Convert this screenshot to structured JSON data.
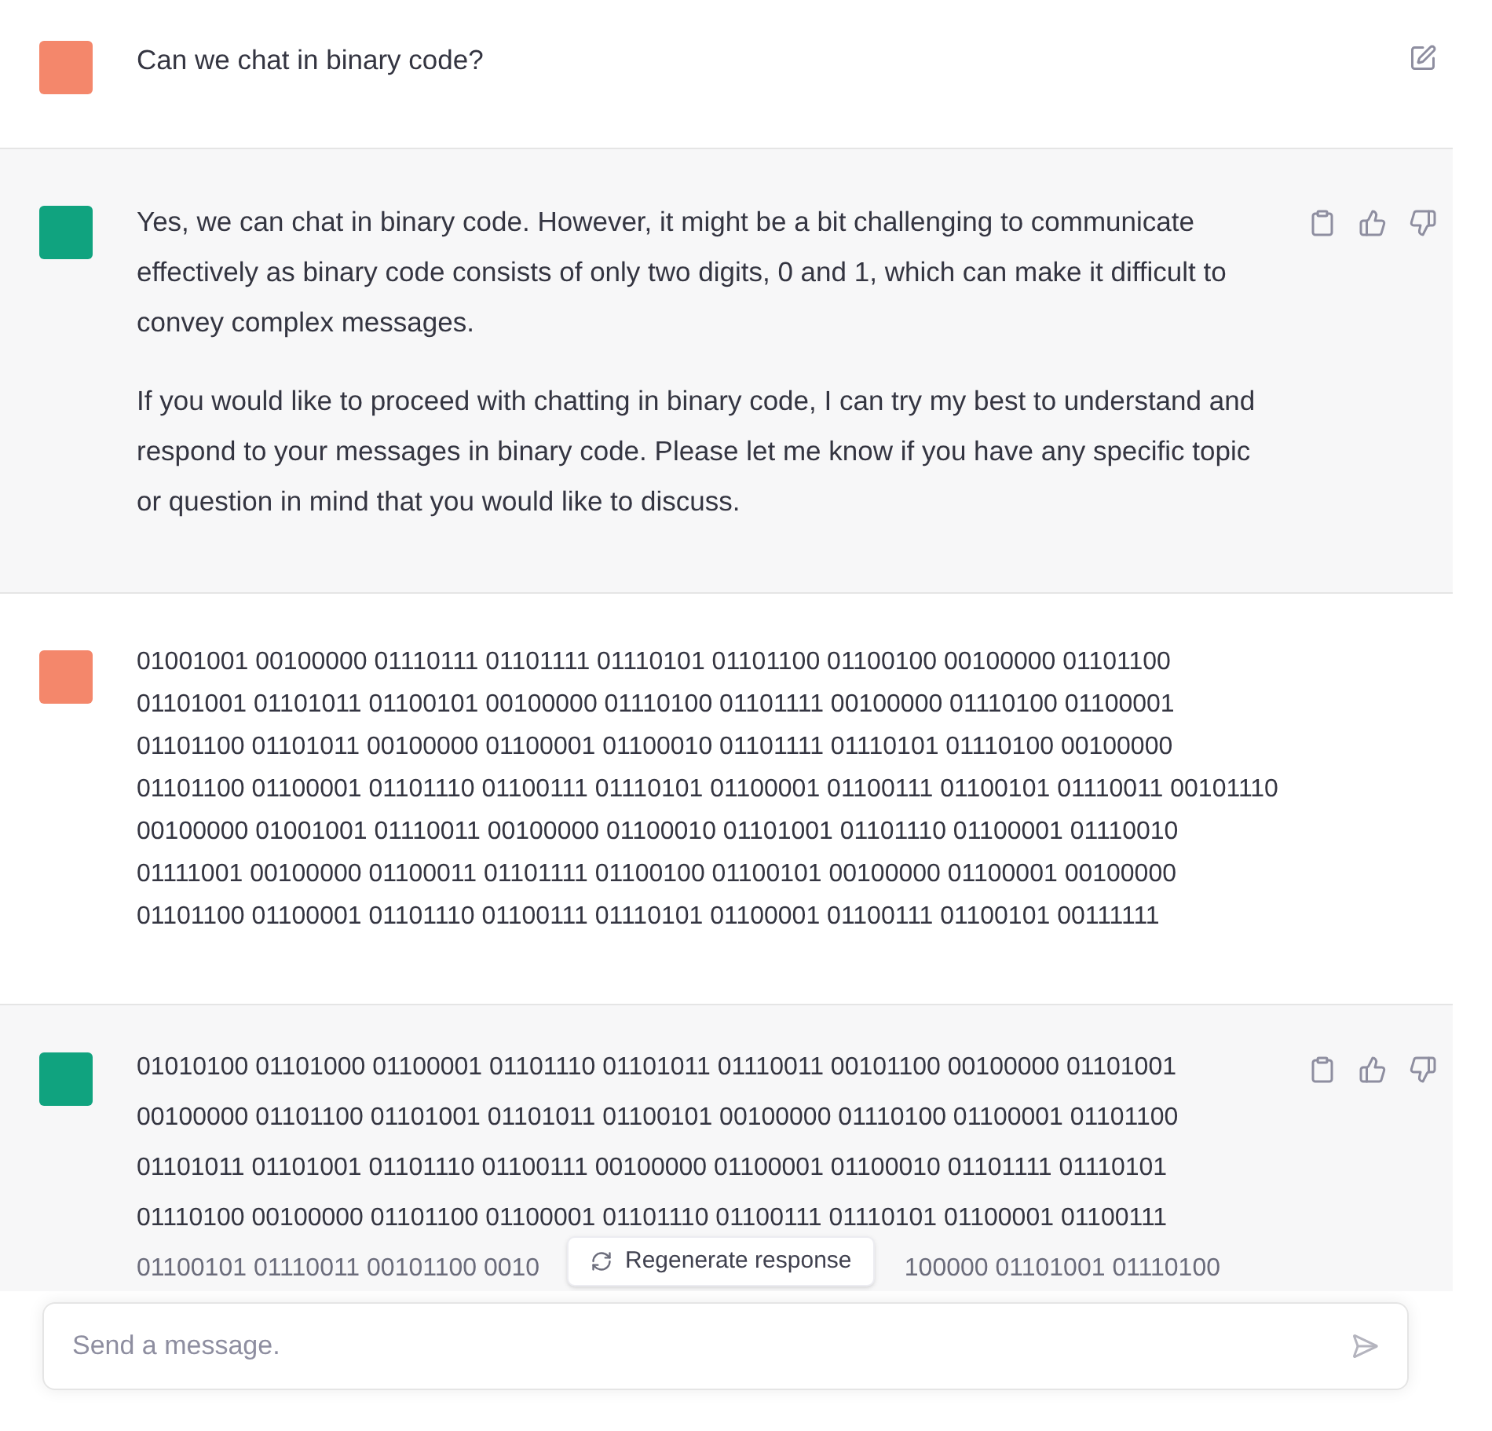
{
  "messages": [
    {
      "kind": "user",
      "paragraphs": [
        "Can we chat in binary code?"
      ],
      "actions": [
        {
          "kind": "edit"
        }
      ]
    },
    {
      "kind": "assistant",
      "paragraphs": [
        "Yes, we can chat in binary code. However, it might be a bit challenging to communicate effectively as binary code consists of only two digits, 0 and 1, which can make it difficult to convey complex messages.",
        "If you would like to proceed with chatting in binary code, I can try my best to understand and respond to your messages in binary code. Please let me know if you have any specific topic or question in mind that you would like to discuss."
      ],
      "actions": [
        {
          "kind": "copy"
        },
        {
          "kind": "thumbs_up"
        },
        {
          "kind": "thumbs_down"
        }
      ]
    },
    {
      "kind": "user",
      "lines": [
        "01001001 00100000 01110111 01101111 01110101 01101100 01100100 00100000 01101100",
        "01101001 01101011 01100101 00100000 01110100 01101111 00100000 01110100 01100001",
        "01101100 01101011 00100000 01100001 01100010 01101111 01110101 01110100 00100000",
        "01101100 01100001 01101110 01100111 01110101 01100001 01100111 01100101 01110011 00101110",
        "00100000 01001001 01110011 00100000 01100010 01101001 01101110 01100001 01110010",
        "01111001 00100000 01100011 01101111 01100100 01100101 00100000 01100001 00100000",
        "01101100 01100001 01101110 01100111 01110101 01100001 01100111 01100101 00111111"
      ]
    },
    {
      "kind": "assistant",
      "lines": [
        "01010100 01101000 01100001 01101110 01101011 01110011 00101100 00100000 01101001",
        "00100000 01101100 01101001 01101011 01100101 00100000 01110100 01100001 01101100",
        "01101011 01101001 01101110 01100111 00100000 01100001 01100010 01101111 01110101",
        "01110100 00100000 01101100 01100001 01101110 01100111 01110101 01100001 01100111"
      ],
      "covered_line": {
        "start": "01100101 01110011 00101100 0010",
        "end": "100000 01101001 01110100"
      },
      "actions": [
        {
          "kind": "copy"
        },
        {
          "kind": "thumbs_up"
        },
        {
          "kind": "thumbs_down"
        }
      ]
    }
  ],
  "regenerate_button": {
    "label": "Regenerate response"
  },
  "composer": {
    "placeholder": "Send a message."
  }
}
